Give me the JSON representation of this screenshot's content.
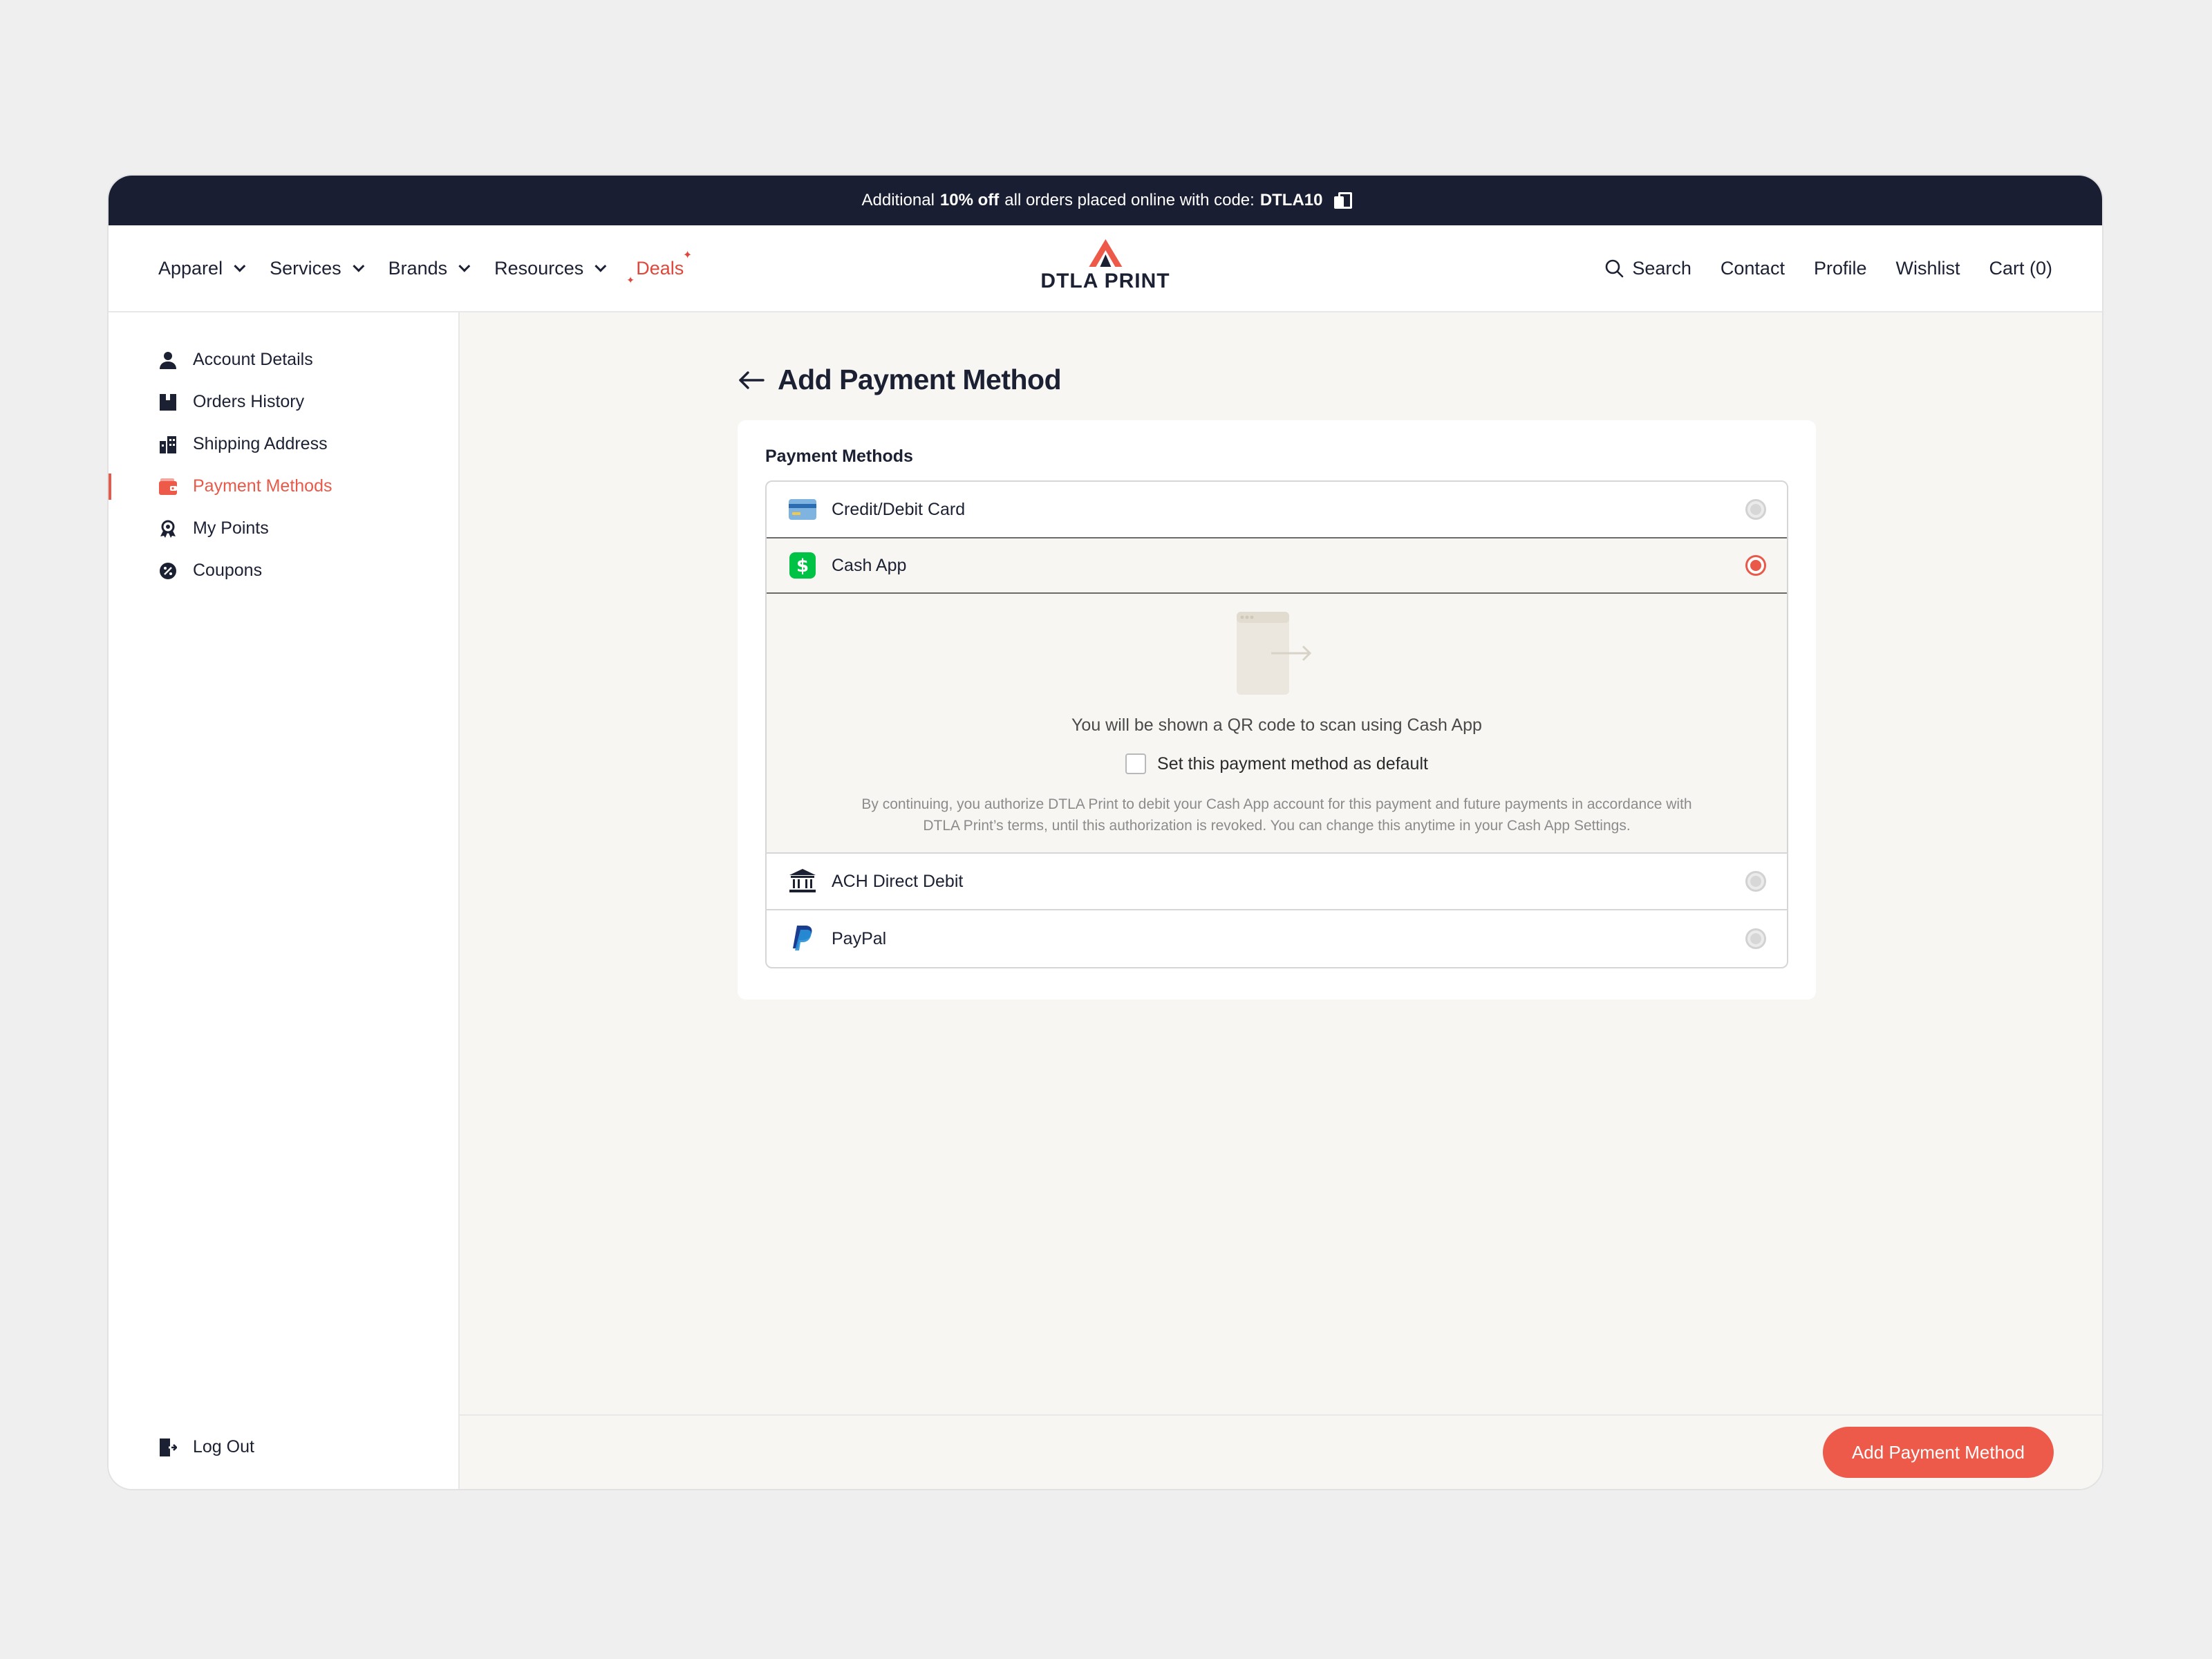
{
  "promo": {
    "prefix": "Additional",
    "discount": "10% off",
    "middle": "all orders placed online with code:",
    "code": "DTLA10"
  },
  "nav": {
    "items": [
      {
        "label": "Apparel"
      },
      {
        "label": "Services"
      },
      {
        "label": "Brands"
      },
      {
        "label": "Resources"
      }
    ],
    "deals": "Deals",
    "logo_text": "DTLA PRINT",
    "right": {
      "search": "Search",
      "contact": "Contact",
      "profile": "Profile",
      "wishlist": "Wishlist",
      "cart": "Cart (0)"
    }
  },
  "sidebar": {
    "items": [
      {
        "label": "Account Details",
        "icon": "user-icon"
      },
      {
        "label": "Orders History",
        "icon": "box-icon"
      },
      {
        "label": "Shipping Address",
        "icon": "building-icon"
      },
      {
        "label": "Payment Methods",
        "icon": "wallet-icon"
      },
      {
        "label": "My Points",
        "icon": "medal-icon"
      },
      {
        "label": "Coupons",
        "icon": "percent-icon"
      }
    ],
    "logout": "Log Out"
  },
  "main": {
    "title": "Add Payment Method",
    "section_label": "Payment Methods",
    "methods": [
      {
        "name": "Credit/Debit Card"
      },
      {
        "name": "Cash App"
      },
      {
        "name": "ACH Direct Debit"
      },
      {
        "name": "PayPal"
      }
    ],
    "cashapp": {
      "qr_text": "You will be shown a QR code to scan using Cash App",
      "default_label": "Set this payment method as default",
      "legal_line1": "By continuing, you authorize DTLA Print to debit your Cash App account for this payment and future payments in accordance with",
      "legal_line2": "DTLA Print’s terms, until this authorization is revoked. You can change this anytime in your Cash App Settings."
    },
    "submit_label": "Add Payment Method"
  },
  "colors": {
    "accent": "#ee5a4a",
    "promo_bg": "#191e33",
    "cashapp_green": "#00c244",
    "paypal_blue": "#1b3d8f"
  }
}
